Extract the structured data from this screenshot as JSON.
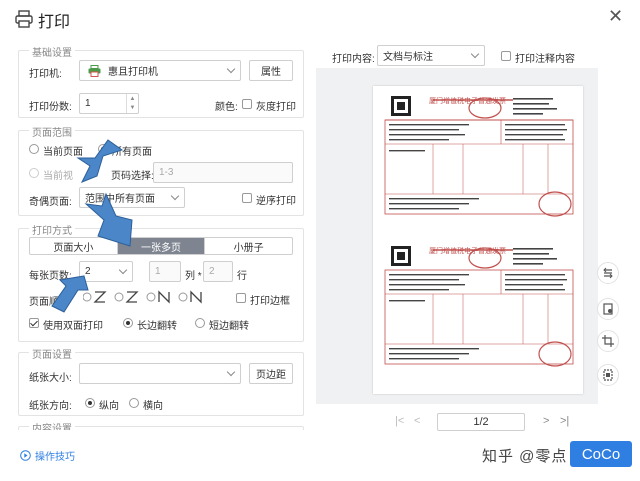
{
  "window": {
    "title": "打印"
  },
  "basic": {
    "title": "基础设置",
    "printer_label": "打印机:",
    "printer_value": "惠且打印机",
    "props_button": "属性",
    "copies_label": "打印份数:",
    "copies_value": "1",
    "color_label": "颜色:",
    "grayscale_label": "灰度打印"
  },
  "range": {
    "title": "页面范围",
    "current_page": "当前页面",
    "all_pages": "所有页面",
    "pages_partial": "当前视",
    "page_select_label": "页码选择:",
    "page_select_placeholder": "1-3",
    "odd_even_label": "奇偶页面:",
    "odd_even_value": "范围中所有页面",
    "reverse_label": "逆序打印"
  },
  "mode": {
    "title": "打印方式",
    "tabs": [
      "页面大小",
      "一张多页",
      "小册子"
    ],
    "per_sheet_label": "每张页数:",
    "per_sheet_value": "2",
    "cols_value": "1",
    "cols_unit": "列 *",
    "rows_value": "2",
    "rows_unit": "行",
    "order_label": "页面顺",
    "print_border_label": "打印边框",
    "duplex_label": "使用双面打印",
    "long_edge_label": "长边翻转",
    "short_edge_label": "短边翻转"
  },
  "page_setup": {
    "title": "页面设置",
    "paper_size_label": "纸张大小:",
    "margins_button": "页边距",
    "orientation_label": "纸张方向:",
    "portrait_label": "纵向",
    "landscape_label": "横向"
  },
  "content": {
    "title": "内容设置"
  },
  "preview": {
    "content_label": "打印内容:",
    "content_value": "文档与标注",
    "annot_label": "打印注释内容",
    "invoice_title": "厦门增值税电子普通发票",
    "page_indicator": "1/2"
  },
  "footer": {
    "tips_label": "操作技巧",
    "watermark": "知乎 @零点",
    "print_button": "CoCo"
  },
  "colors": {
    "accent": "#2f7fe3",
    "seg_selected": "#7e8590",
    "arrow": "#4a86c8",
    "invoice_red": "#c0504d"
  }
}
